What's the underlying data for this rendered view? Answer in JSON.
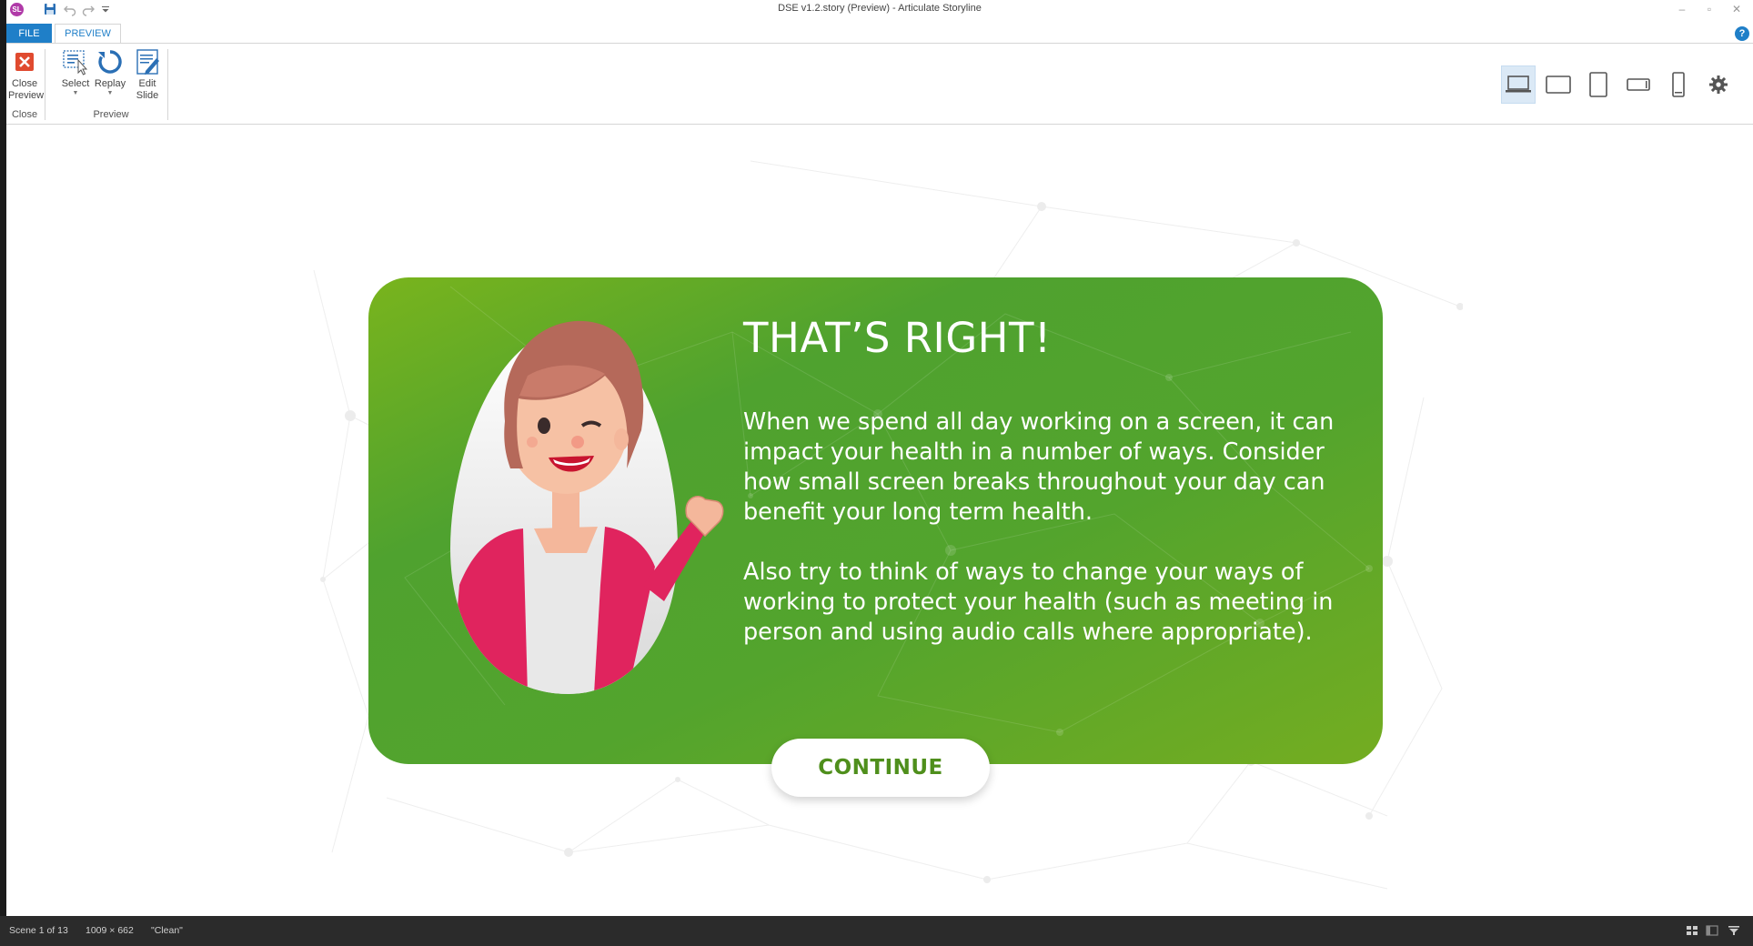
{
  "window": {
    "title": "DSE v1.2.story (Preview) -  Articulate Storyline",
    "app_logo": "SL"
  },
  "ribbon": {
    "tabs": [
      {
        "label": "FILE"
      },
      {
        "label": "PREVIEW"
      }
    ],
    "help": "?",
    "buttons": {
      "close_preview_line1": "Close",
      "close_preview_line2": "Preview",
      "select": "Select",
      "replay": "Replay",
      "edit_slide_line1": "Edit",
      "edit_slide_line2": "Slide"
    },
    "groups": {
      "close": "Close",
      "preview": "Preview"
    },
    "device_icons": [
      "laptop-icon",
      "tablet-landscape-icon",
      "tablet-portrait-icon",
      "phone-landscape-icon",
      "phone-portrait-icon",
      "settings-icon"
    ],
    "active_device": "laptop"
  },
  "slide": {
    "headline": "THAT’S RIGHT!",
    "paragraph1": "When we spend all day working on a screen, it can impact your health in a number of ways. Consider how small screen breaks throughout your day can benefit your long term health.",
    "paragraph2": "Also try to think of ways to change your ways of working to protect your health (such as meeting in person and using audio calls where appropriate).",
    "continue_label": "CONTINUE",
    "colors": {
      "card_green": "#53a42d",
      "card_light_green": "#79b41d",
      "button_text": "#4f8f1c",
      "character_jacket": "#e0245e",
      "character_hair": "#b5695a"
    }
  },
  "status": {
    "scene": "Scene 1 of 13",
    "dimensions": "1009 × 662",
    "theme": "\"Clean\""
  }
}
